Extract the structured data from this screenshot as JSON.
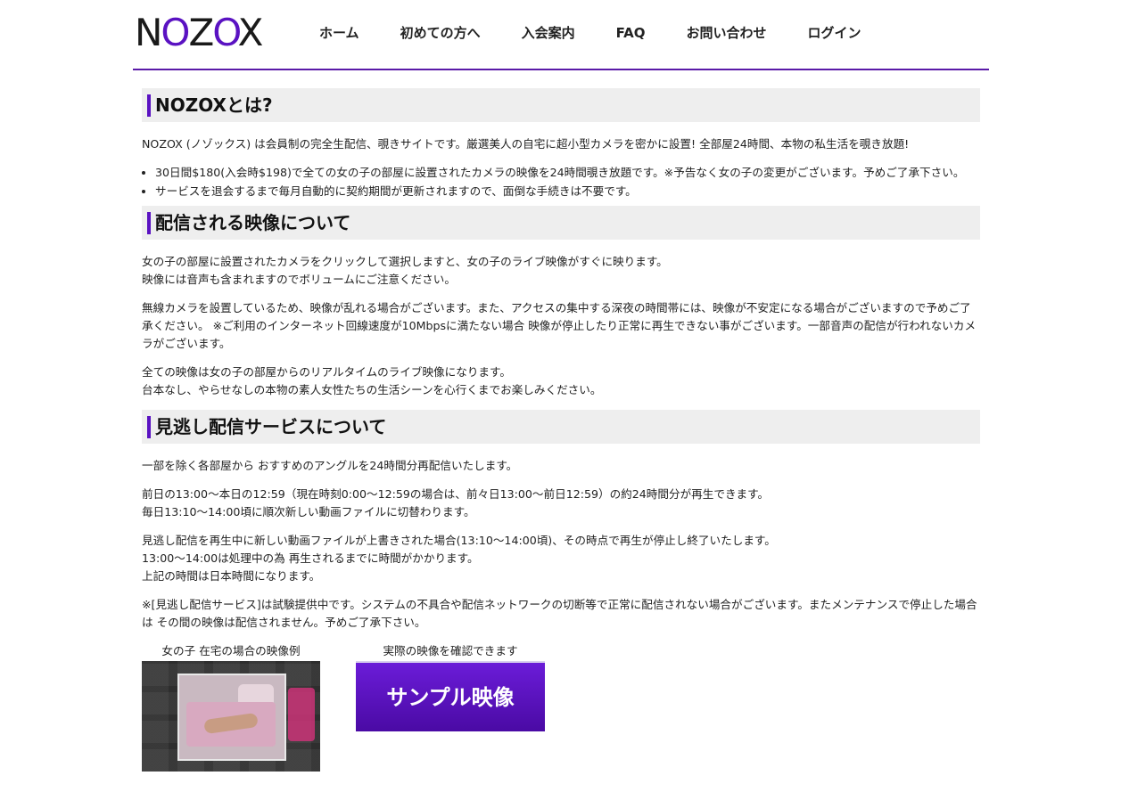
{
  "header": {
    "logo": {
      "n": "N",
      "o1": "O",
      "z": "Z",
      "o2": "O",
      "x": "X"
    },
    "nav": [
      "ホーム",
      "初めての方へ",
      "入会案内",
      "FAQ",
      "お問い合わせ",
      "ログイン"
    ]
  },
  "about": {
    "title": "NOZOXとは?",
    "intro": "NOZOX (ノゾックス) は会員制の完全生配信、覗きサイトです。厳選美人の自宅に超小型カメラを密かに設置! 全部屋24時間、本物の私生活を覗き放題!",
    "bullets": [
      "30日間$180(入会時$198)で全ての女の子の部屋に設置されたカメラの映像を24時間覗き放題です。※予告なく女の子の変更がございます。予めご了承下さい。",
      "サービスを退会するまで毎月自動的に契約期間が更新されますので、面倒な手続きは不要です。"
    ]
  },
  "video": {
    "title": "配信される映像について",
    "p1_line1": "女の子の部屋に設置されたカメラをクリックして選択しますと、女の子のライブ映像がすぐに映ります。",
    "p1_line2": "映像には音声も含まれますのでボリュームにご注意ください。",
    "p2": "無線カメラを設置しているため、映像が乱れる場合がございます。また、アクセスの集中する深夜の時間帯には、映像が不安定になる場合がございますので予めご了承ください。 ※ご利用のインターネット回線速度が10Mbpsに満たない場合 映像が停止したり正常に再生できない事がございます。一部音声の配信が行われないカメラがございます。",
    "p3_line1": "全ての映像は女の子の部屋からのリアルタイムのライブ映像になります。",
    "p3_line2": "台本なし、やらせなしの本物の素人女性たちの生活シーンを心行くまでお楽しみください。"
  },
  "missed": {
    "title": "見逃し配信サービスについて",
    "p1": "一部を除く各部屋から おすすめのアングルを24時間分再配信いたします。",
    "p2_line1": "前日の13:00～本日の12:59（現在時刻0:00～12:59の場合は、前々日13:00～前日12:59）の約24時間分が再生できます。",
    "p2_line2": "毎日13:10～14:00頃に順次新しい動画ファイルに切替わります。",
    "p3_line1": "見逃し配信を再生中に新しい動画ファイルが上書きされた場合(13:10～14:00頃)、その時点で再生が停止し終了いたします。",
    "p3_line2": "13:00～14:00は処理中の為 再生されるまでに時間がかかります。",
    "p3_line3": "上記の時間は日本時間になります。",
    "p4": "※[見逃し配信サービス]は試験提供中です。システムの不具合や配信ネットワークの切断等で正常に配信されない場合がございます。またメンテナンスで停止した場合は その間の映像は配信されません。予めご了承下さい。"
  },
  "samples": {
    "left_caption": "女の子 在宅の場合の映像例",
    "right_caption": "実際の映像を確認できます",
    "button_label": "サンプル映像"
  }
}
